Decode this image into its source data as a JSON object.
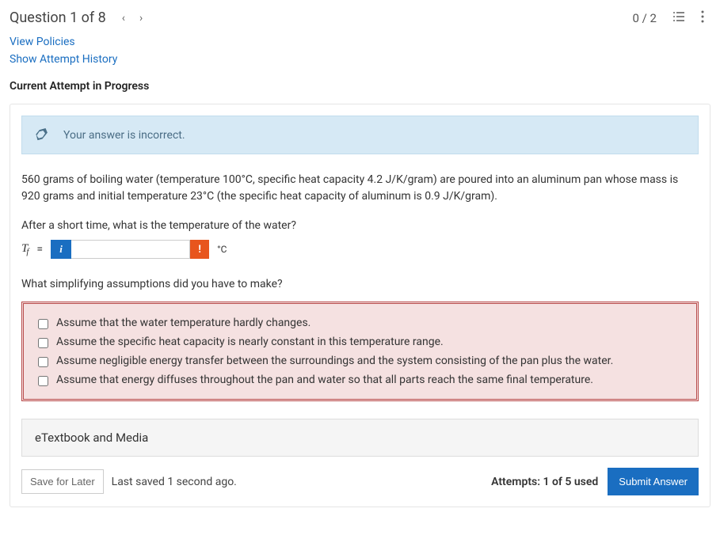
{
  "header": {
    "question_label": "Question 1 of 8",
    "score": "0 / 2"
  },
  "links": {
    "view_policies": "View Policies",
    "show_history": "Show Attempt History"
  },
  "section_title": "Current Attempt in Progress",
  "feedback": {
    "text": "Your answer is incorrect."
  },
  "question": {
    "body": "560 grams of boiling water (temperature 100°C, specific heat capacity 4.2 J/K/gram) are poured into an aluminum pan whose mass is 920 grams and initial temperature 23°C (the specific heat capacity of aluminum is 0.9 J/K/gram).",
    "prompt1": "After a short time, what is the temperature of the water?",
    "var": "T",
    "sub": "f",
    "equals": "=",
    "unit": "°C",
    "info_icon": "i",
    "error_icon": "!",
    "prompt2": "What simplifying assumptions did you have to make?",
    "assumptions": [
      "Assume that the water temperature hardly changes.",
      "Assume the specific heat capacity is nearly constant in this temperature range.",
      "Assume negligible energy transfer between the surroundings and the system consisting of the pan plus the water.",
      "Assume that energy diffuses throughout the pan and water so that all parts reach the same final temperature."
    ]
  },
  "etextbook": "eTextbook and Media",
  "footer": {
    "save_label": "Save for Later",
    "saved_text": "Last saved 1 second ago.",
    "attempts": "Attempts: 1 of 5 used",
    "submit_label": "Submit Answer"
  }
}
